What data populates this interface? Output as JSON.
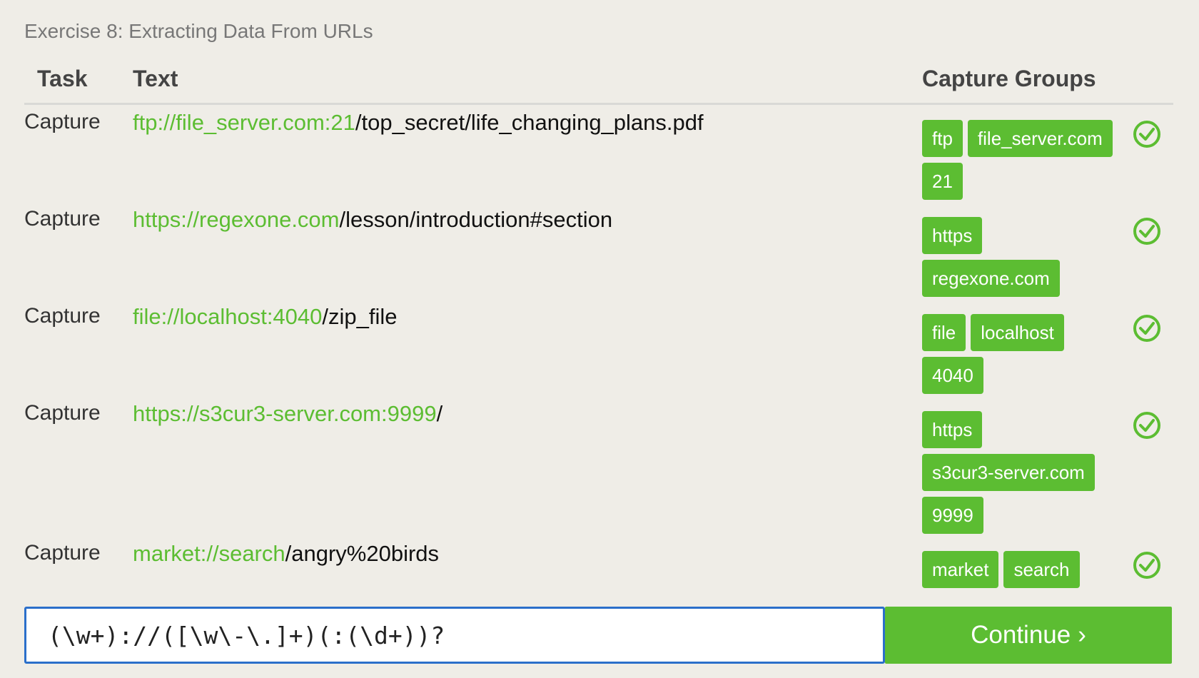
{
  "exercise": {
    "title": "Exercise 8: Extracting Data From URLs"
  },
  "table": {
    "headers": {
      "task": "Task",
      "text": "Text",
      "groups": "Capture Groups"
    },
    "rows": [
      {
        "task": "Capture",
        "match": "ftp://file_server.com:21",
        "rest": "/top_secret/life_changing_plans.pdf",
        "groups": [
          "ftp",
          "file_server.com",
          "21"
        ],
        "status_icon": "check-circle-icon"
      },
      {
        "task": "Capture",
        "match": "https://regexone.com",
        "rest": "/lesson/introduction#section",
        "groups": [
          "https",
          "regexone.com"
        ],
        "status_icon": "check-circle-icon"
      },
      {
        "task": "Capture",
        "match": "file://localhost:4040",
        "rest": "/zip_file",
        "groups": [
          "file",
          "localhost",
          "4040"
        ],
        "status_icon": "check-circle-icon"
      },
      {
        "task": "Capture",
        "match": "https://s3cur3-server.com:9999",
        "rest": "/",
        "groups": [
          "https",
          "s3cur3-server.com",
          "9999"
        ],
        "status_icon": "check-circle-icon"
      },
      {
        "task": "Capture",
        "match": "market://search",
        "rest": "/angry%20birds",
        "groups": [
          "market",
          "search"
        ],
        "status_icon": "check-circle-icon"
      }
    ]
  },
  "input": {
    "value": "(\\w+)://([\\w\\-\\.]+)(:(\\d+))?"
  },
  "continue_button": {
    "label": "Continue",
    "arrow": "›"
  },
  "colors": {
    "accent_green": "#5cbd32",
    "input_border": "#2b6fca",
    "background": "#efede7"
  }
}
